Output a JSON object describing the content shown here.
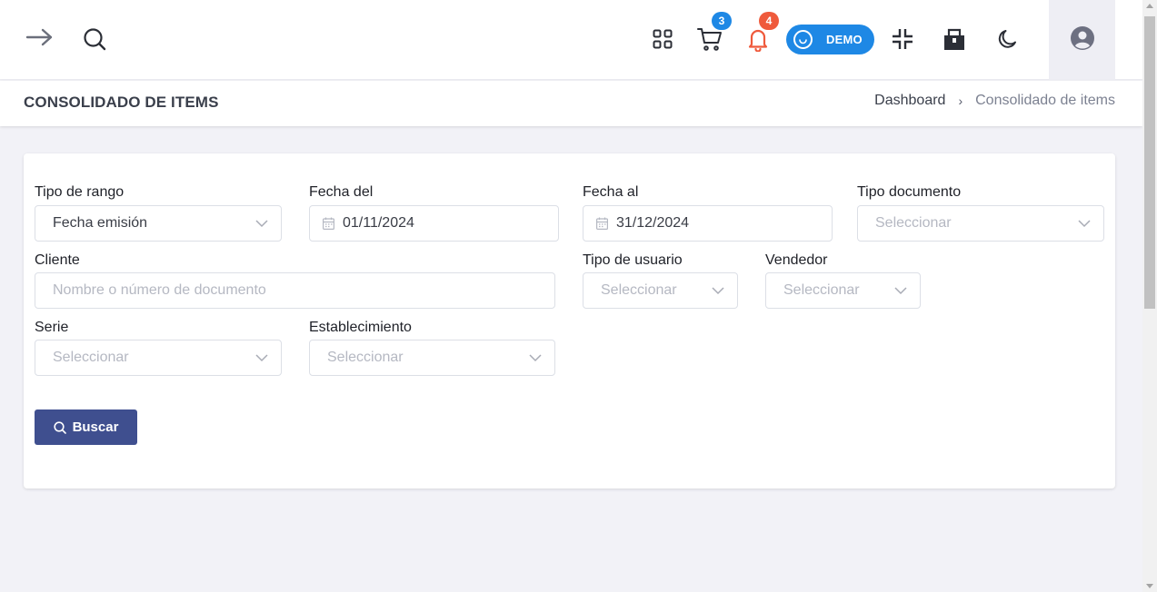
{
  "topbar": {
    "icons": [
      "arrow-right-icon",
      "search-icon",
      "apps-grid-icon",
      "cart-icon",
      "bell-icon",
      "smiley-icon",
      "collapse-icon",
      "store-icon",
      "moon-icon",
      "user-circle-icon"
    ],
    "cart_count": "3",
    "notifications_count": "4",
    "demo_label": "DEMO",
    "colors": {
      "cart_badge": "#1e88e5",
      "bell": "#ef5a3c",
      "demo": "#1e88e5"
    }
  },
  "page": {
    "title": "CONSOLIDADO DE ITEMS",
    "breadcrumb": {
      "home": "Dashboard",
      "separator": "›",
      "current": "Consolidado de items"
    }
  },
  "form": {
    "tipo_rango": {
      "label": "Tipo de rango",
      "value": "Fecha emisión"
    },
    "fecha_del": {
      "label": "Fecha del",
      "value": "01/11/2024"
    },
    "fecha_al": {
      "label": "Fecha al",
      "value": "31/12/2024"
    },
    "tipo_documento": {
      "label": "Tipo documento",
      "placeholder": "Seleccionar"
    },
    "cliente": {
      "label": "Cliente",
      "placeholder": "Nombre o número de documento"
    },
    "tipo_usuario": {
      "label": "Tipo de usuario",
      "placeholder": "Seleccionar"
    },
    "vendedor": {
      "label": "Vendedor",
      "placeholder": "Seleccionar"
    },
    "serie": {
      "label": "Serie",
      "placeholder": "Seleccionar"
    },
    "establecimiento": {
      "label": "Establecimiento",
      "placeholder": "Seleccionar"
    },
    "search_button": "Buscar",
    "button_color": "#3f4f8f"
  }
}
